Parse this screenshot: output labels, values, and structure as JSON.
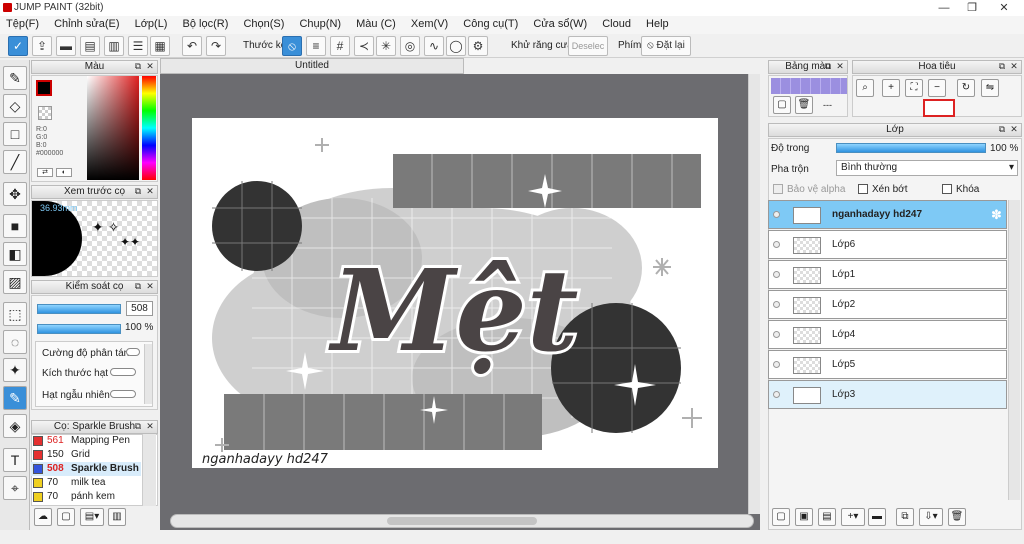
{
  "window": {
    "title": "JUMP PAINT (32bit)",
    "minimize": "—",
    "maximize": "❐",
    "close": "✕"
  },
  "menu": [
    "Tệp(F)",
    "Chỉnh sửa(E)",
    "Lớp(L)",
    "Bộ lọc(R)",
    "Chọn(S)",
    "Chụp(N)",
    "Màu (C)",
    "Xem(V)",
    "Công cụ(T)",
    "Cửa sổ(W)",
    "Cloud",
    "Help"
  ],
  "toolbar": {
    "ruler_label": "Thước kẻ",
    "antialias_label": "Khử răng cưa",
    "deselect_label": "Deselec",
    "keys_label": "Phím",
    "reset_label": "Đặt lại"
  },
  "color_panel": {
    "title": "Màu",
    "r": "R:0",
    "g": "G:0",
    "b": "B:0",
    "hex": "#000000",
    "fg": "#000000",
    "bg": "#ffffff"
  },
  "preview_panel": {
    "title": "Xem trước cọ",
    "size": "36.93mm"
  },
  "brush_control": {
    "title": "Kiểm soát cọ",
    "size_value": "508",
    "opacity_value": "100 %",
    "scatter_label": "Cường độ phân tán",
    "grain_label": "Kích thước hạt",
    "random_label": "Hạt ngẫu nhiên"
  },
  "brush_list": {
    "title": "Cọ: Sparkle Brush",
    "items": [
      {
        "size": "561",
        "name": "Mapping Pen",
        "color": "#e53030"
      },
      {
        "size": "150",
        "name": "Grid",
        "color": "#e53030"
      },
      {
        "size": "508",
        "name": "Sparkle Brush",
        "color": "#3355dd",
        "selected": true
      },
      {
        "size": "70",
        "name": "milk tea",
        "color": "#f0d020"
      },
      {
        "size": "70",
        "name": "pánh kem",
        "color": "#f0d020"
      }
    ]
  },
  "canvas": {
    "tab": "Untitled",
    "title_text": "Mệt",
    "signature": "nganhadayy hd247"
  },
  "palette_panel": {
    "title": "Bảng màu"
  },
  "navigator_panel": {
    "title": "Hoa tiêu"
  },
  "layer_panel": {
    "title": "Lớp",
    "opacity_label": "Độ trong",
    "opacity_value": "100 %",
    "opacity_fraction": 1.0,
    "blend_label": "Pha trộn",
    "blend_value": "Bình thường",
    "alpha_label": "Bảo vệ alpha",
    "clip_label": "Xén bớt",
    "lock_label": "Khóa",
    "layers": [
      {
        "name": "nganhadayy hd247",
        "state": "selected"
      },
      {
        "name": "Lớp6",
        "state": ""
      },
      {
        "name": "Lớp1",
        "state": ""
      },
      {
        "name": "Lớp2",
        "state": ""
      },
      {
        "name": "Lớp4",
        "state": ""
      },
      {
        "name": "Lớp5",
        "state": ""
      },
      {
        "name": "Lớp3",
        "state": "sub"
      }
    ]
  }
}
